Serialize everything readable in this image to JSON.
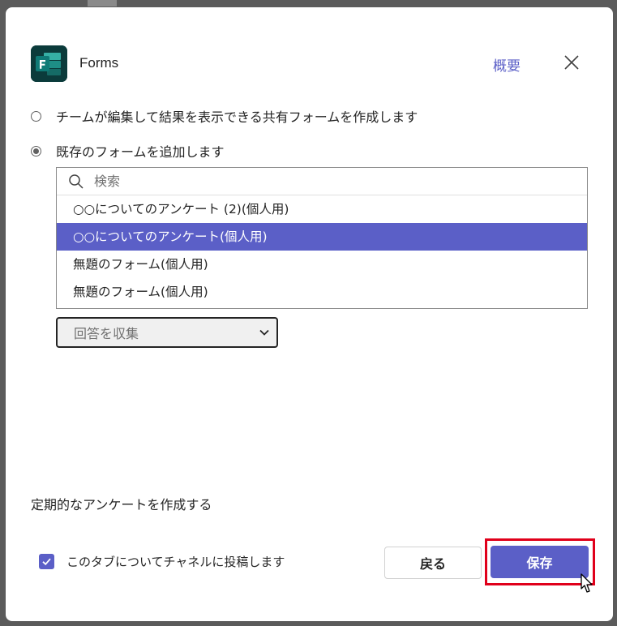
{
  "header": {
    "app_name": "Forms",
    "about_link": "概要",
    "close_icon": "close-icon"
  },
  "options": {
    "create_shared": "チームが編集して結果を表示できる共有フォームを作成します",
    "add_existing": "既存のフォームを追加します",
    "selected_option": "add_existing"
  },
  "picker": {
    "search_placeholder": "検索",
    "items": [
      {
        "label": "○○についてのアンケート (2)(個人用)",
        "selected": false
      },
      {
        "label": "○○についてのアンケート(個人用)",
        "selected": true
      },
      {
        "label": "無題のフォーム(個人用)",
        "selected": false
      },
      {
        "label": "無題のフォーム(個人用)",
        "selected": false
      }
    ]
  },
  "mode_select": {
    "value": "回答を収集"
  },
  "recurring_label": "定期的なアンケートを作成する",
  "footer": {
    "post_checkbox_label": "このタブについてチャネルに投稿します",
    "post_checked": true,
    "back_label": "戻る",
    "save_label": "保存"
  },
  "colors": {
    "accent": "#5b5fc7",
    "highlight": "#e0001b",
    "logo_bg": "#0b3b3b"
  }
}
